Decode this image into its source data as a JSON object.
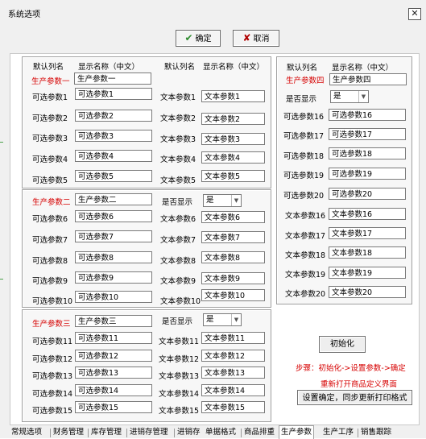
{
  "window": {
    "title": "系统选项"
  },
  "toolbar": {
    "ok_label": "确定",
    "cancel_label": "取消"
  },
  "p1": {
    "hdr_default": "默认列名",
    "hdr_display": "显示名称（中文）",
    "main_label": "生产参数一",
    "main_value": "生产参数一",
    "rows": [
      {
        "label": "可选参数1",
        "value": "可选参数1"
      },
      {
        "label": "可选参数2",
        "value": "可选参数2"
      },
      {
        "label": "可选参数3",
        "value": "可选参数3"
      },
      {
        "label": "可选参数4",
        "value": "可选参数4"
      },
      {
        "label": "可选参数5",
        "value": "可选参数5"
      }
    ],
    "hdr2_default": "默认列名",
    "hdr2_display": "显示名称（中文）",
    "text_rows": [
      {
        "label": "文本参数1",
        "value": "文本参数1"
      },
      {
        "label": "文本参数2",
        "value": "文本参数2"
      },
      {
        "label": "文本参数3",
        "value": "文本参数3"
      },
      {
        "label": "文本参数4",
        "value": "文本参数4"
      },
      {
        "label": "文本参数5",
        "value": "文本参数5"
      }
    ]
  },
  "p2": {
    "main_label": "生产参数二",
    "main_value": "生产参数二",
    "show_label": "是否显示",
    "show_value": "是",
    "rows": [
      {
        "label": "可选参数6",
        "value": "可选参数6"
      },
      {
        "label": "可选参数7",
        "value": "可选参数7"
      },
      {
        "label": "可选参数8",
        "value": "可选参数8"
      },
      {
        "label": "可选参数9",
        "value": "可选参数9"
      },
      {
        "label": "可选参数10",
        "value": "可选参数10"
      }
    ],
    "text_rows": [
      {
        "label": "文本参数6",
        "value": "文本参数6"
      },
      {
        "label": "文本参数7",
        "value": "文本参数7"
      },
      {
        "label": "文本参数8",
        "value": "文本参数8"
      },
      {
        "label": "文本参数9",
        "value": "文本参数9"
      },
      {
        "label": "文本参数10",
        "value": "文本参数10"
      }
    ]
  },
  "p3": {
    "main_label": "生产参数三",
    "main_value": "生产参数三",
    "show_label": "是否显示",
    "show_value": "是",
    "rows": [
      {
        "label": "可选参数11",
        "value": "可选参数11"
      },
      {
        "label": "可选参数12",
        "value": "可选参数12"
      },
      {
        "label": "可选参数13",
        "value": "可选参数13"
      },
      {
        "label": "可选参数14",
        "value": "可选参数14"
      },
      {
        "label": "可选参数15",
        "value": "可选参数15"
      }
    ],
    "text_rows": [
      {
        "label": "文本参数11",
        "value": "文本参数11"
      },
      {
        "label": "文本参数12",
        "value": "文本参数12"
      },
      {
        "label": "文本参数13",
        "value": "文本参数13"
      },
      {
        "label": "文本参数14",
        "value": "文本参数14"
      },
      {
        "label": "文本参数15",
        "value": "文本参数15"
      }
    ]
  },
  "p4": {
    "hdr_default": "默认列名",
    "hdr_display": "显示名称（中文）",
    "main_label": "生产参数四",
    "main_value": "生产参数四",
    "show_label": "是否显示",
    "show_value": "是",
    "rows": [
      {
        "label": "可选参数16",
        "value": "可选参数16"
      },
      {
        "label": "可选参数17",
        "value": "可选参数17"
      },
      {
        "label": "可选参数18",
        "value": "可选参数18"
      },
      {
        "label": "可选参数19",
        "value": "可选参数19"
      },
      {
        "label": "可选参数20",
        "value": "可选参数20"
      },
      {
        "label": "文本参数16",
        "value": "文本参数16"
      },
      {
        "label": "文本参数17",
        "value": "文本参数17"
      },
      {
        "label": "文本参数18",
        "value": "文本参数18"
      },
      {
        "label": "文本参数19",
        "value": "文本参数19"
      },
      {
        "label": "文本参数20",
        "value": "文本参数20"
      }
    ]
  },
  "actions": {
    "init_label": "初始化",
    "steps_text": "步骤：初始化->设置参数->确定",
    "reopen_text": "重新打开商品定义界面",
    "sync_label": "设置确定，同步更新打印格式"
  },
  "tabs": [
    "常规选项",
    "财务管理",
    "库存管理",
    "进销存管理",
    "进销存",
    "单据格式",
    "商品排重",
    "生产参数",
    "生产工序",
    "销售跟踪"
  ],
  "active_tab": 7,
  "colors": {
    "accent_red": "#d60000",
    "ok_check": "#2e8b2e",
    "cancel_x": "#b00000"
  }
}
